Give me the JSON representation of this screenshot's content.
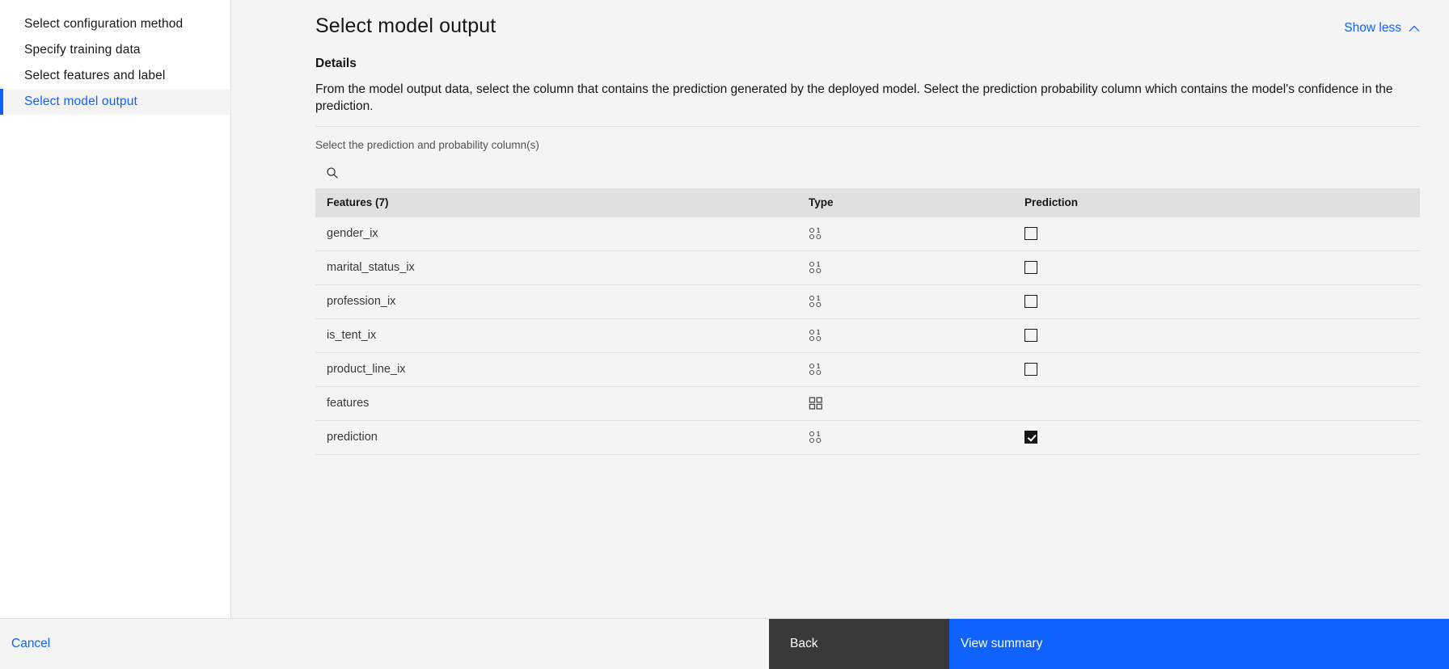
{
  "sidebar": {
    "items": [
      {
        "label": "Select configuration method",
        "active": false
      },
      {
        "label": "Specify training data",
        "active": false
      },
      {
        "label": "Select features and label",
        "active": false
      },
      {
        "label": "Select model output",
        "active": true
      }
    ]
  },
  "header": {
    "title": "Select model output",
    "show_less_label": "Show less",
    "show_less_icon": "chevron-up-icon"
  },
  "details": {
    "heading": "Details",
    "text": "From the model output data, select the column that contains the prediction generated by the deployed model. Select the prediction probability column which contains the model's confidence in the prediction."
  },
  "selection": {
    "hint": "Select the prediction and probability column(s)",
    "search_placeholder": "",
    "search_value": "",
    "search_icon": "search-icon"
  },
  "table": {
    "columns": {
      "features": "Features (7)",
      "type": "Type",
      "prediction": "Prediction"
    },
    "rows": [
      {
        "name": "gender_ix",
        "type_icon": "binary-type-icon",
        "has_checkbox": true,
        "checked": false
      },
      {
        "name": "marital_status_ix",
        "type_icon": "binary-type-icon",
        "has_checkbox": true,
        "checked": false
      },
      {
        "name": "profession_ix",
        "type_icon": "binary-type-icon",
        "has_checkbox": true,
        "checked": false
      },
      {
        "name": "is_tent_ix",
        "type_icon": "binary-type-icon",
        "has_checkbox": true,
        "checked": false
      },
      {
        "name": "product_line_ix",
        "type_icon": "binary-type-icon",
        "has_checkbox": true,
        "checked": false
      },
      {
        "name": "features",
        "type_icon": "array-type-icon",
        "has_checkbox": false,
        "checked": false
      },
      {
        "name": "prediction",
        "type_icon": "binary-type-icon",
        "has_checkbox": true,
        "checked": true
      }
    ]
  },
  "footer": {
    "cancel_label": "Cancel",
    "back_label": "Back",
    "summary_label": "View summary"
  },
  "colors": {
    "accent_blue": "#0f62fe",
    "dark_button": "#393939",
    "page_bg": "#f4f4f4",
    "header_row_bg": "#e0e0e0",
    "border": "#e0e0e0"
  }
}
